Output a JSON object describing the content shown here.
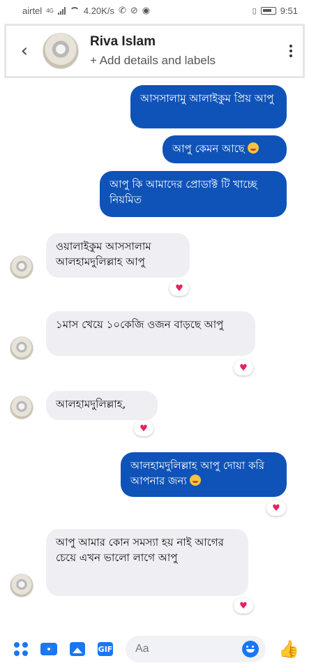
{
  "status_bar": {
    "carrier": "airtel",
    "network": "4G",
    "speed": "4.20K/s",
    "time": "9:51"
  },
  "header": {
    "name": "Riva Islam",
    "subtitle": "+ Add details and labels"
  },
  "messages": [
    {
      "direction": "outgoing",
      "text": "আসসালামু আলাইকুম প্রিয় আপু"
    },
    {
      "direction": "outgoing",
      "text": "আপু কেমন আছে",
      "emoji": "smiling-face-with-hearts"
    },
    {
      "direction": "outgoing",
      "text": "আপু কি আমাদের প্রোডাক্ট টি খাচ্ছে নিয়মিত"
    },
    {
      "direction": "incoming",
      "text": "ওয়ালাইকুম আসসালাম আলহামদুলিল্লাহ আপু",
      "reaction": "heart"
    },
    {
      "direction": "incoming",
      "text": "১মাস খেয়ে ১০কেজি ওজন বাড়ছে আপু",
      "reaction": "heart"
    },
    {
      "direction": "incoming",
      "text": "আলহামদুলিল্লাহ,",
      "reaction": "heart"
    },
    {
      "direction": "outgoing",
      "text": "আলহামদুলিল্লাহ আপু দোয়া করি আপনার জন্য",
      "emoji": "smiling-face-with-hearts",
      "reaction": "heart"
    },
    {
      "direction": "incoming",
      "text": "আপু আমার কোন সমস্যা হয় নাই আগের চেয়ে এখন ভালো লাগে আপু",
      "reaction": "heart"
    }
  ],
  "composer": {
    "placeholder": "Aa",
    "gif_label": "GIF"
  },
  "colors": {
    "outgoing_bubble": "#0f53b8",
    "incoming_bubble": "#efeff3",
    "accent": "#1877f2",
    "heart": "#e0245e"
  }
}
